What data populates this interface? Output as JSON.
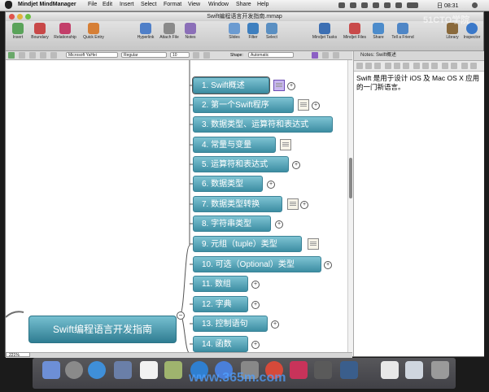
{
  "menubar": {
    "app": "Mindjet MindManager",
    "items": [
      "File",
      "Edit",
      "Insert",
      "Select",
      "Format",
      "View",
      "Window",
      "Share",
      "Help"
    ],
    "clock": "日 08:31"
  },
  "window": {
    "title": "Swift编程语言开发指南.mmap"
  },
  "toolbar": {
    "buttons": [
      "Insert",
      "Boundary",
      "Relationship",
      "Quick Entry",
      "Hyperlink",
      "Attach File",
      "Notes",
      "Slides",
      "Filter",
      "Select",
      "Mindjet Tasks",
      "Mindjet Files",
      "Share",
      "Tell a Friend",
      "Library",
      "Inspector"
    ]
  },
  "format": {
    "font": "Microsoft YaHei",
    "style": "Regular",
    "size": "10",
    "shape_label": "Shape:",
    "shape": "Automatic"
  },
  "map": {
    "central": "Swift编程语言开发指南",
    "topics": [
      "1. Swift概述",
      "2. 第一个Swift程序",
      "3. 数据类型、运算符和表达式",
      "4. 常量与变量",
      "5. 运算符和表达式",
      "6. 数据类型",
      "7. 数据类型转换",
      "8. 字符串类型",
      "9. 元组（tuple）类型",
      "10. 可选（Optional）类型",
      "11. 数组",
      "12. 字典",
      "13. 控制语句",
      "14. 函数"
    ]
  },
  "notes": {
    "header": "Notes: Swift概述",
    "body": "Swift 是用于设计 iOS 及 Mac OS X 应用的一门新语言。"
  },
  "status": {
    "zoom": "221%"
  },
  "watermarks": {
    "top": "51CTO学院",
    "bottom": "www.365m.com"
  }
}
